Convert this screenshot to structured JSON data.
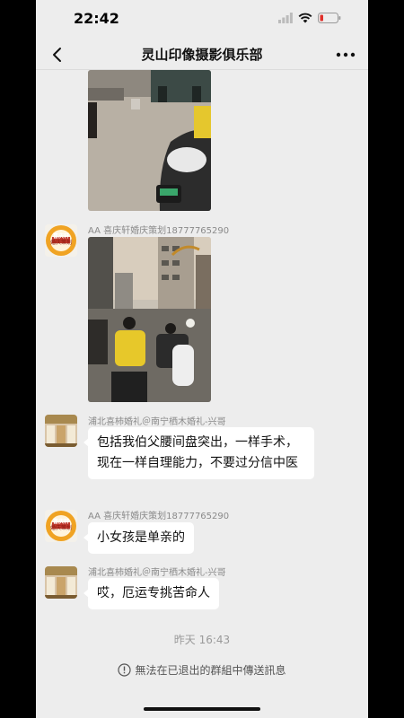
{
  "status_bar": {
    "time": "22:42"
  },
  "header": {
    "title": "灵山印像摄影俱乐部"
  },
  "messages": [
    {
      "sender": "AA 喜庆轩婚庆策划18777765290"
    },
    {
      "sender": "浦北喜柿婚礼＠南宁栖木婚礼-兴哥",
      "text": "包括我伯父腰间盘突出，一样手术，现在一样自理能力，不要过分信中医"
    },
    {
      "sender": "AA 喜庆轩婚庆策划18777765290",
      "text": "小女孩是单亲的"
    },
    {
      "sender": "浦北喜柿婚礼＠南宁栖木婚礼-兴哥",
      "text": "哎，厄运专挑苦命人"
    }
  ],
  "timestamp": "昨天 16:43",
  "footer_notice": "無法在已退出的群組中傳送訊息",
  "logo": {
    "top": "喜庆轩",
    "bottom": "婚庆策划"
  },
  "colors": {
    "background": "#ededed",
    "bubble": "#ffffff",
    "logo_orange": "#f0a323",
    "logo_red": "#c0392b"
  }
}
